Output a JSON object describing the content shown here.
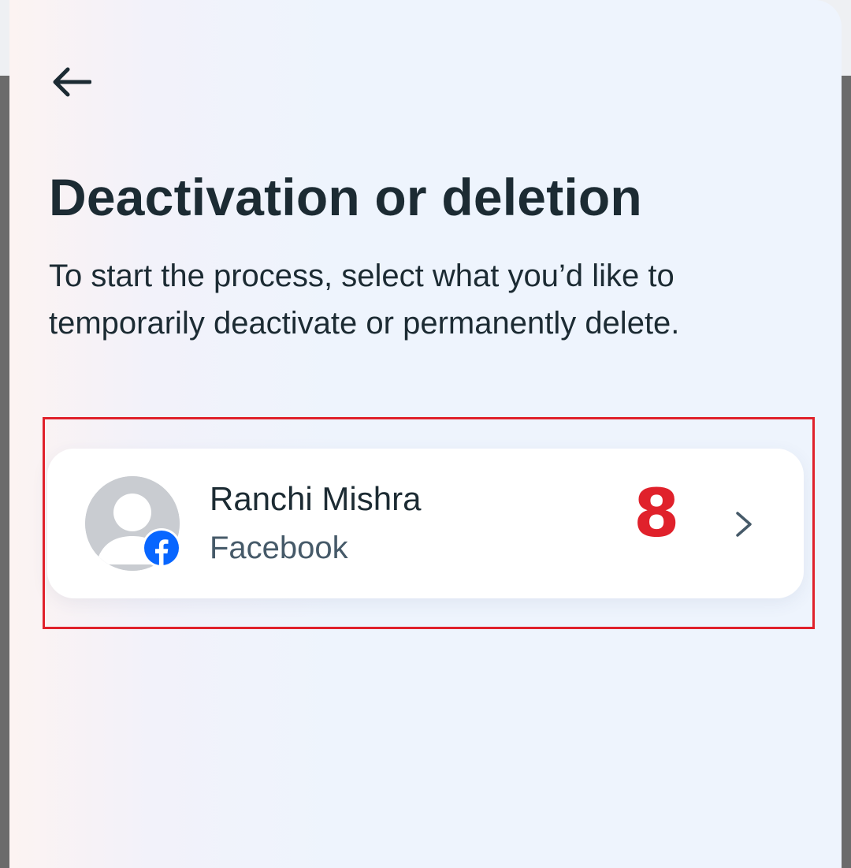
{
  "header": {
    "back_icon": "arrow-left-icon"
  },
  "page": {
    "title": "Deactivation or deletion",
    "description": "To start the process, select what you’d like to temporarily deactivate or permanently delete."
  },
  "accounts": [
    {
      "name": "Ranchi Mishra",
      "platform": "Facebook",
      "avatar_icon": "default-avatar-icon",
      "badge_icon": "facebook-logo-icon",
      "chevron_icon": "chevron-right-icon"
    }
  ],
  "annotation": {
    "label": "8",
    "color": "#e0212b"
  },
  "colors": {
    "text_primary": "#1c2b33",
    "text_secondary": "#465a69",
    "facebook_blue": "#0866ff"
  }
}
